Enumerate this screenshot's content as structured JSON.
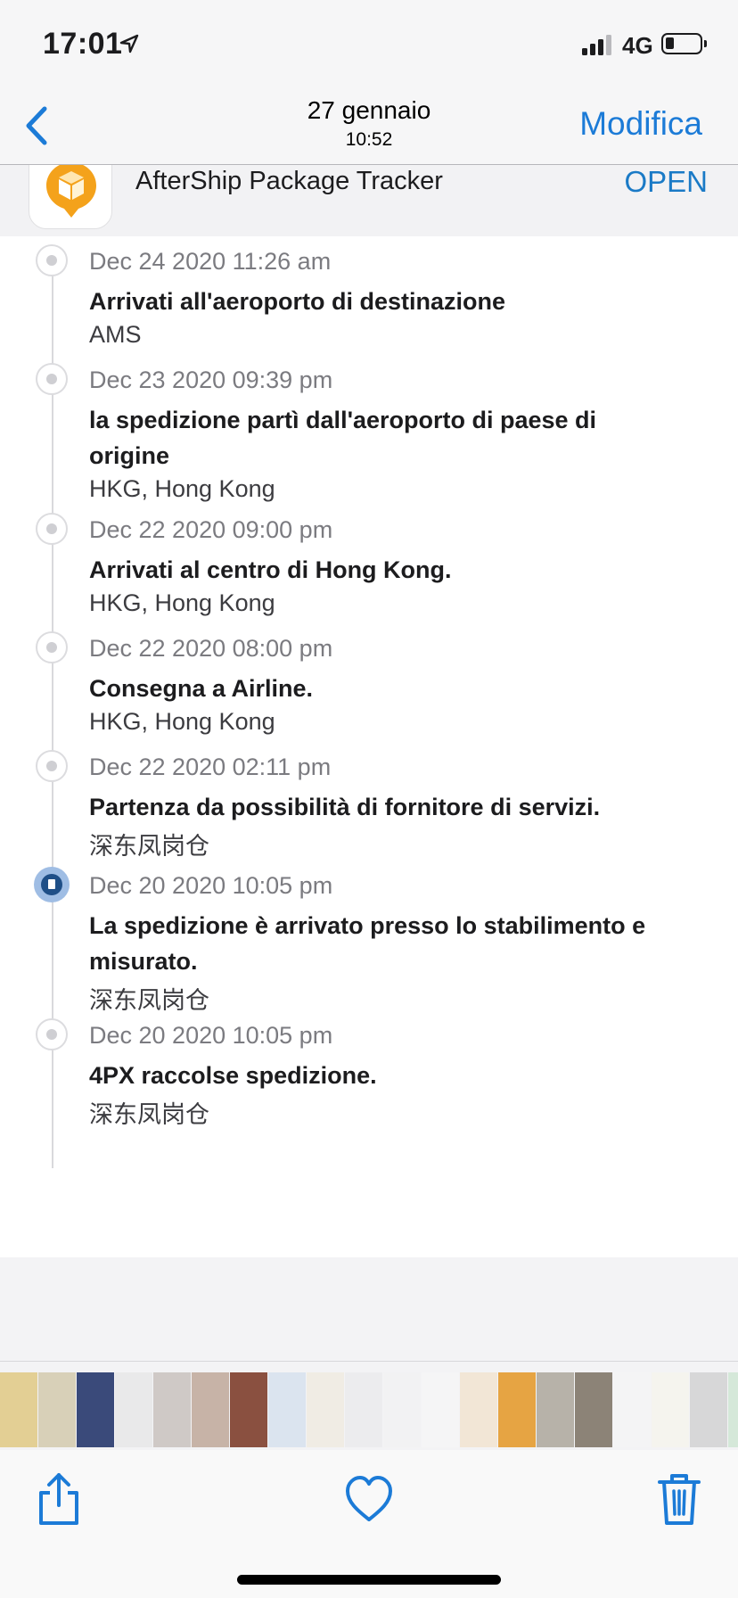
{
  "status_bar": {
    "time": "17:01",
    "network": "4G",
    "signal_bars": 3,
    "signal_bars_total": 4,
    "battery_level": 0.25
  },
  "nav": {
    "back_icon": "chevron-left-icon",
    "title": "27 gennaio",
    "subtitle": "10:52",
    "edit_label": "Modifica"
  },
  "app_banner": {
    "icon": "aftership-logo",
    "name": "AfterShip Package Tracker",
    "open_label": "OPEN"
  },
  "events": [
    {
      "date": "Dec 24 2020 11:26 am",
      "title_lines": [
        "Arrivati all'aeroporto di destinazione"
      ],
      "location": "AMS",
      "active": false
    },
    {
      "date": "Dec 23 2020 09:39 pm",
      "title_lines": [
        "la spedizione partì dall'aeroporto di paese di",
        "origine"
      ],
      "location": "HKG, Hong Kong",
      "active": false
    },
    {
      "date": "Dec 22 2020 09:00 pm",
      "title_lines": [
        "Arrivati al centro di Hong Kong."
      ],
      "location": "HKG, Hong Kong",
      "active": false
    },
    {
      "date": "Dec 22 2020 08:00 pm",
      "title_lines": [
        "Consegna a Airline."
      ],
      "location": "HKG, Hong Kong",
      "active": false
    },
    {
      "date": "Dec 22 2020 02:11 pm",
      "title_lines": [
        "Partenza da possibilità di fornitore di servizi."
      ],
      "location": "深东凤岗仓",
      "active": false
    },
    {
      "date": "Dec 20 2020 10:05 pm",
      "title_lines": [
        "La spedizione è arrivato presso lo stabilimento e",
        "misurato."
      ],
      "location": "深东凤岗仓",
      "active": true
    },
    {
      "date": "Dec 20 2020 10:05 pm",
      "title_lines": [
        "4PX raccolse spedizione."
      ],
      "location": "深东凤岗仓",
      "active": false
    }
  ],
  "thumbnails": [
    {
      "color": "#e3cf94"
    },
    {
      "color": "#d8d0b8"
    },
    {
      "color": "#3a4a7a"
    },
    {
      "color": "#e9e9ea"
    },
    {
      "color": "#cfc9c6"
    },
    {
      "color": "#c7b3a7"
    },
    {
      "color": "#8a5040"
    },
    {
      "color": "#dbe4ef"
    },
    {
      "color": "#f0ece4"
    },
    {
      "color": "#ececee"
    },
    {
      "color": "#f2f2f3"
    },
    {
      "color": "#f5f5f6"
    },
    {
      "color": "#f2e6d6"
    },
    {
      "color": "#e6a443"
    },
    {
      "color": "#b7b2a9"
    },
    {
      "color": "#8c8377"
    },
    {
      "color": "#f4f4f5"
    },
    {
      "color": "#f5f4ee"
    },
    {
      "color": "#d7d7d8"
    },
    {
      "color": "#d5e8d9"
    },
    {
      "color": "#2a4e8a"
    }
  ],
  "toolbar": {
    "share_icon": "share-icon",
    "favorite_icon": "heart-icon",
    "delete_icon": "trash-icon"
  }
}
